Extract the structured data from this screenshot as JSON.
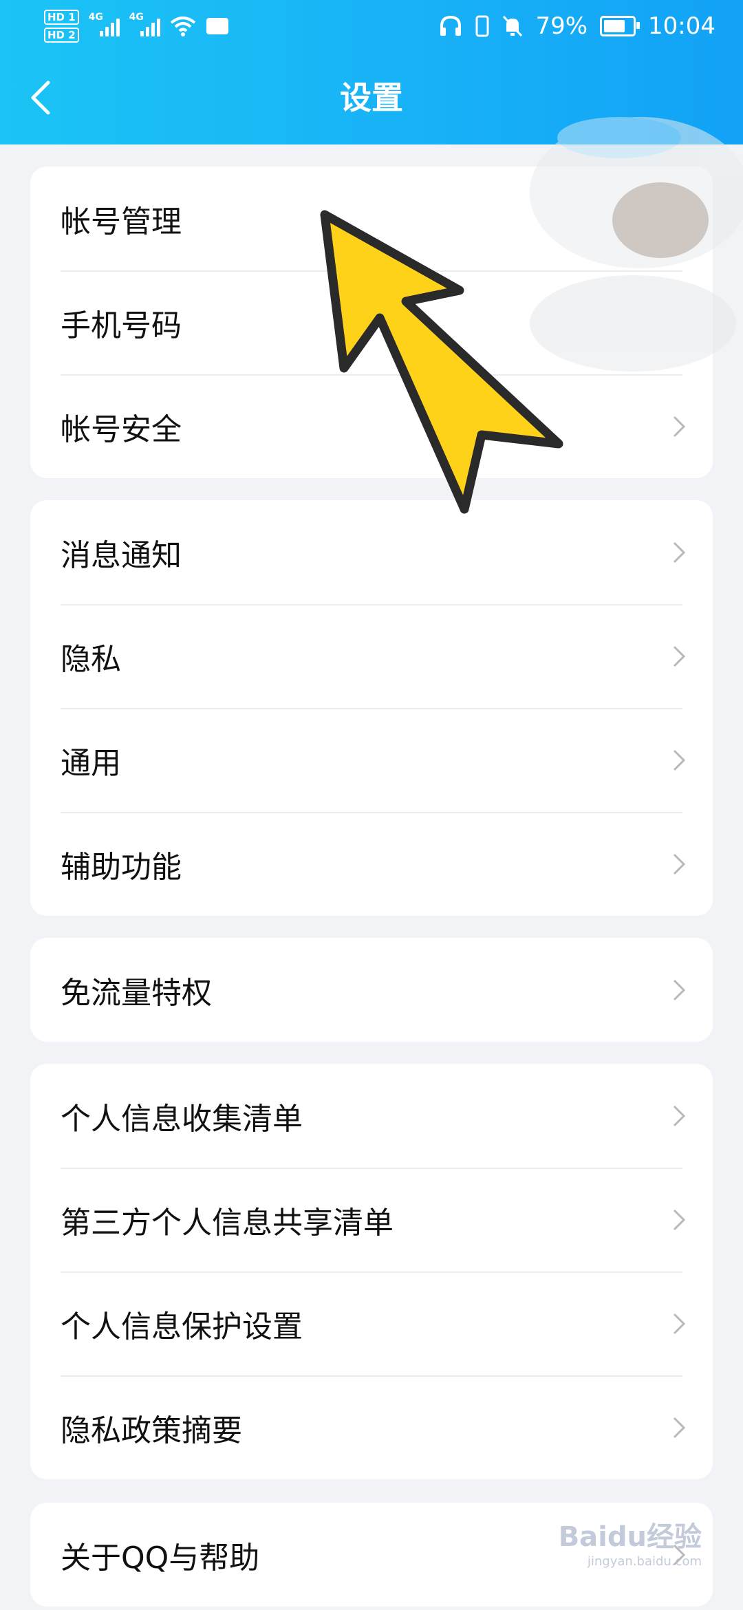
{
  "status_bar": {
    "sim1": "HD 1",
    "sim2": "HD 2",
    "net1": "4G",
    "net2": "4G",
    "battery": "79%",
    "time": "10:04",
    "icons": [
      "wifi-icon",
      "message-icon",
      "headphone-icon",
      "vibrate-icon",
      "mute-icon",
      "battery-icon"
    ]
  },
  "header": {
    "title": "设置"
  },
  "sections": [
    {
      "items": [
        {
          "label": "帐号管理"
        },
        {
          "label": "手机号码"
        },
        {
          "label": "帐号安全"
        }
      ]
    },
    {
      "items": [
        {
          "label": "消息通知"
        },
        {
          "label": "隐私"
        },
        {
          "label": "通用"
        },
        {
          "label": "辅助功能"
        }
      ]
    },
    {
      "items": [
        {
          "label": "免流量特权"
        }
      ]
    },
    {
      "items": [
        {
          "label": "个人信息收集清单"
        },
        {
          "label": "第三方个人信息共享清单"
        },
        {
          "label": "个人信息保护设置"
        },
        {
          "label": "隐私政策摘要"
        }
      ]
    },
    {
      "items": [
        {
          "label": "关于QQ与帮助"
        }
      ]
    }
  ],
  "watermark": {
    "brand": "Baidu经验",
    "url": "jingyan.baidu.com"
  },
  "colors": {
    "header": "#18b2f7",
    "annotation_arrow": "#ffd21a"
  }
}
